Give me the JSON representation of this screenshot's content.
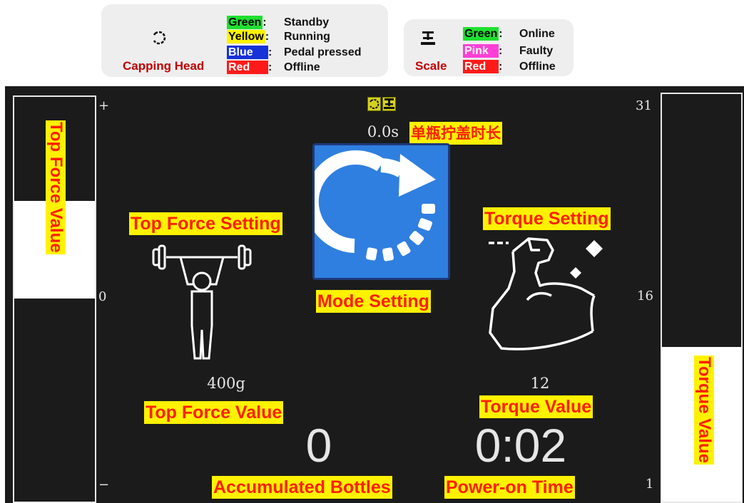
{
  "legend_capping": {
    "title": "Capping Head",
    "icon": "capping-head-icon",
    "rows": [
      {
        "color": "Green",
        "sep": ":",
        "text": "Standby"
      },
      {
        "color": "Yellow",
        "sep": ":",
        "text": "Running"
      },
      {
        "color": "Blue",
        "sep": ":",
        "text": "Pedal pressed"
      },
      {
        "color": "Red",
        "sep": ":",
        "text": "Offline"
      }
    ]
  },
  "legend_scale": {
    "title": "Scale",
    "icon": "scale-icon",
    "rows": [
      {
        "color": "Green",
        "sep": ":",
        "text": "Online"
      },
      {
        "color": "Pink",
        "sep": ":",
        "text": "Faulty"
      },
      {
        "color": "Red",
        "sep": ":",
        "text": "Offline"
      }
    ]
  },
  "colors": {
    "green": "#1ee02f",
    "yellow": "#fff200",
    "blue": "#1732d8",
    "red": "#ff1a1a",
    "pink": "#ff3fd6",
    "screen_bg": "#1b1b1b",
    "annotation_bg": "#fff200",
    "annotation_text": "#ff1e00",
    "mode_button": "#2f7fe0"
  },
  "screen": {
    "left_bar": {
      "tick_top": "+",
      "tick_mid": "0",
      "tick_bottom": "−",
      "label": "Top Force Value"
    },
    "right_bar": {
      "tick_top": "31",
      "tick_mid": "16",
      "tick_bottom": "1",
      "label": "Torque Value",
      "level": 0.38
    },
    "status_icons": [
      "capping-head-icon",
      "scale-icon"
    ],
    "cycle_time": {
      "value": "0.0s",
      "label": "单瓶拧盖时长"
    },
    "mode": {
      "label": "Mode Setting",
      "icon": "refresh-arrow-icon"
    },
    "top_force": {
      "setting_label": "Top Force Setting",
      "value": "400g",
      "value_label": "Top Force Value",
      "icon": "weightlifter-icon"
    },
    "torque": {
      "setting_label": "Torque Setting",
      "value": "12",
      "value_label": "Torque Value",
      "icon": "flexed-arm-icon"
    },
    "bottles": {
      "value": "0",
      "label": "Accumulated Bottles"
    },
    "power_on": {
      "value": "0:02",
      "label": "Power-on Time"
    }
  }
}
